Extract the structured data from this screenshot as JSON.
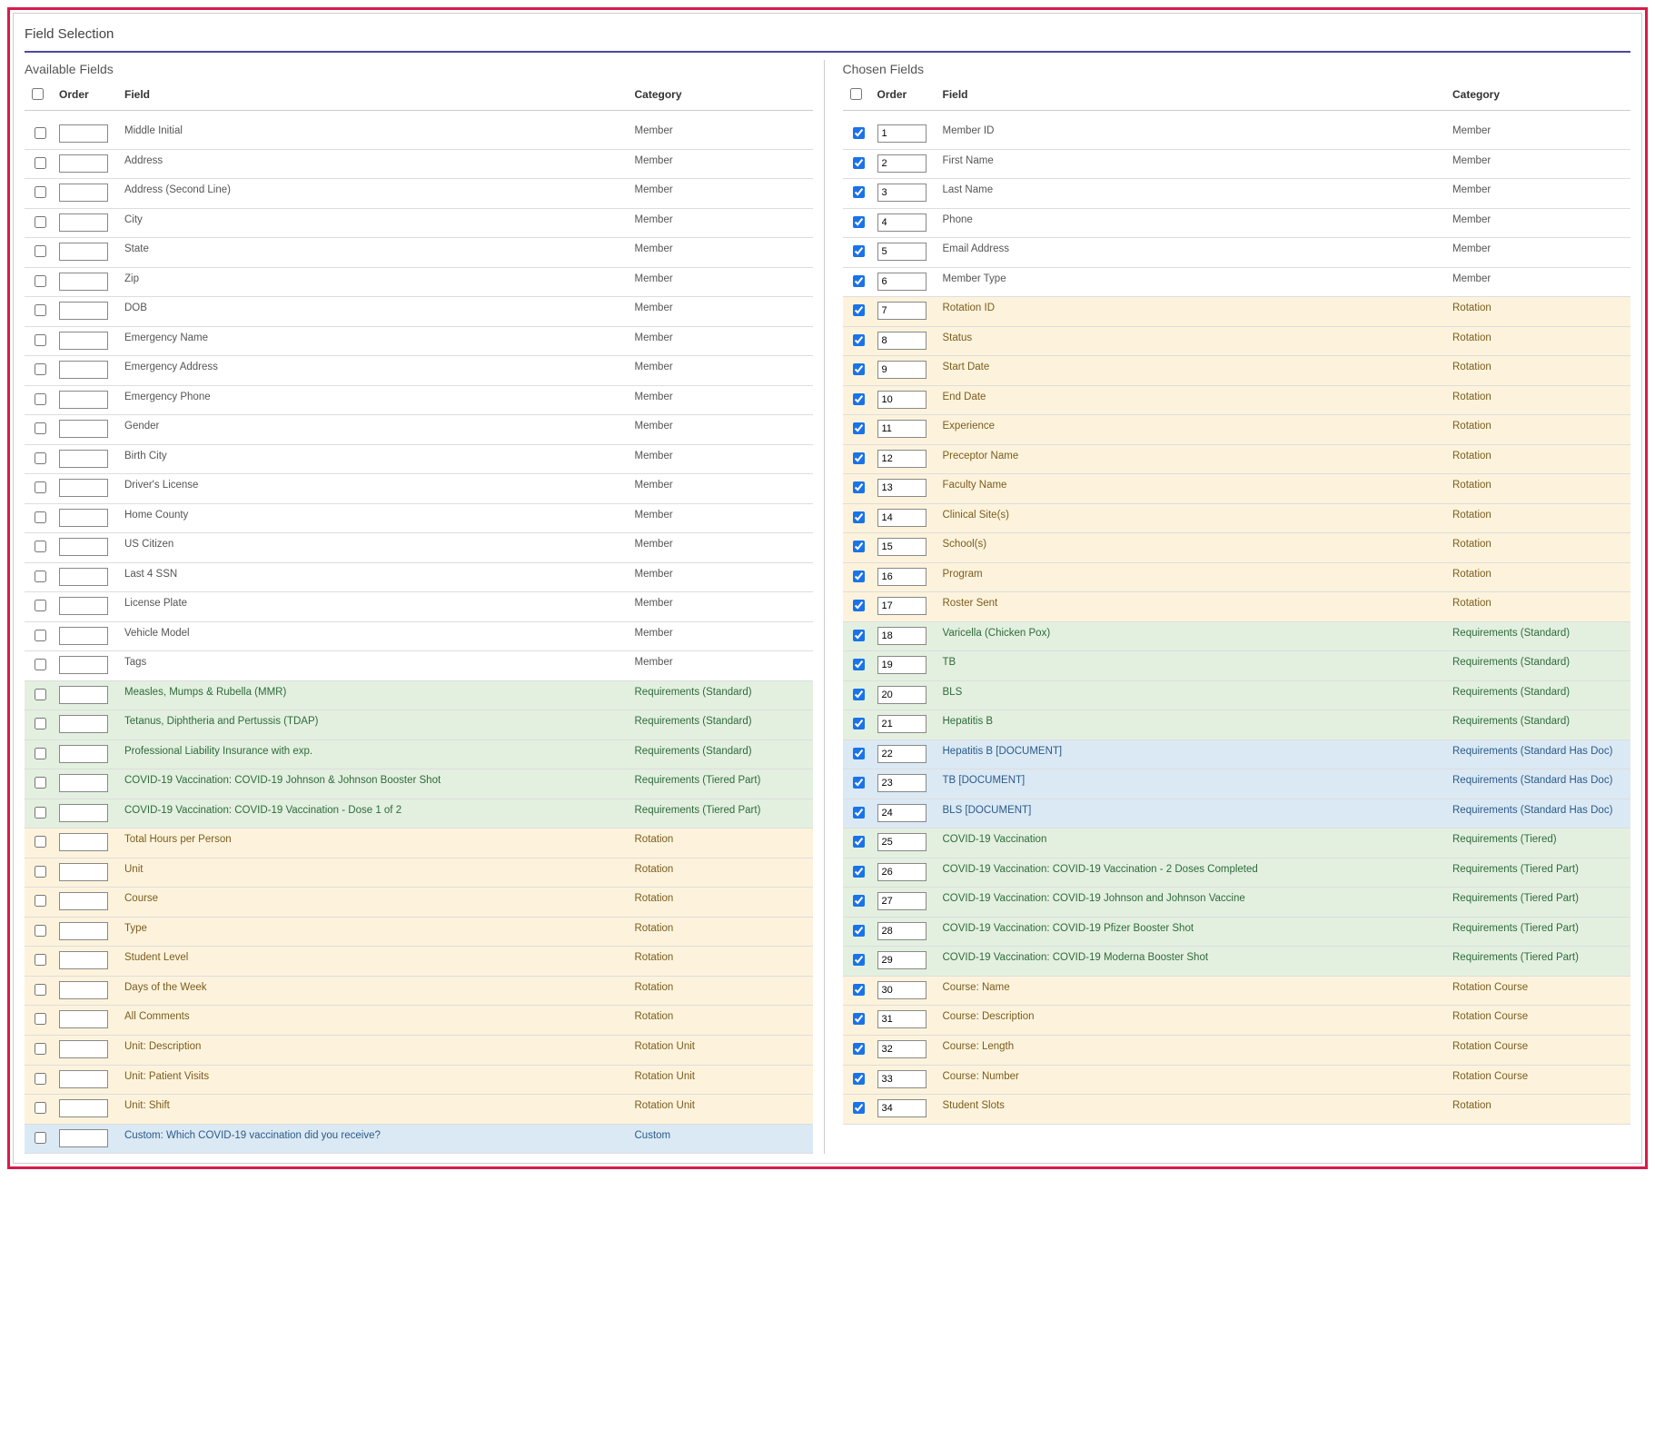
{
  "title": "Field Selection",
  "subtitles": {
    "available": "Available Fields",
    "chosen": "Chosen Fields"
  },
  "headers": {
    "order": "Order",
    "field": "Field",
    "category": "Category"
  },
  "category_labels": {
    "member": "Member",
    "rotation": "Rotation",
    "rotunit": "Rotation Unit",
    "rotcourse": "Rotation Course",
    "reqstd": "Requirements (Standard)",
    "reqdoc": "Requirements (Standard Has Doc)",
    "reqtier": "Requirements (Tiered)",
    "reqtierp": "Requirements (Tiered Part)",
    "custom": "Custom"
  },
  "available_rows": [
    {
      "field": "Middle Initial",
      "cat": "member",
      "order": ""
    },
    {
      "field": "Address",
      "cat": "member",
      "order": ""
    },
    {
      "field": "Address (Second Line)",
      "cat": "member",
      "order": ""
    },
    {
      "field": "City",
      "cat": "member",
      "order": ""
    },
    {
      "field": "State",
      "cat": "member",
      "order": ""
    },
    {
      "field": "Zip",
      "cat": "member",
      "order": ""
    },
    {
      "field": "DOB",
      "cat": "member",
      "order": ""
    },
    {
      "field": "Emergency Name",
      "cat": "member",
      "order": ""
    },
    {
      "field": "Emergency Address",
      "cat": "member",
      "order": ""
    },
    {
      "field": "Emergency Phone",
      "cat": "member",
      "order": ""
    },
    {
      "field": "Gender",
      "cat": "member",
      "order": ""
    },
    {
      "field": "Birth City",
      "cat": "member",
      "order": ""
    },
    {
      "field": "Driver's License",
      "cat": "member",
      "order": ""
    },
    {
      "field": "Home County",
      "cat": "member",
      "order": ""
    },
    {
      "field": "US Citizen",
      "cat": "member",
      "order": ""
    },
    {
      "field": "Last 4 SSN",
      "cat": "member",
      "order": ""
    },
    {
      "field": "License Plate",
      "cat": "member",
      "order": ""
    },
    {
      "field": "Vehicle Model",
      "cat": "member",
      "order": ""
    },
    {
      "field": "Tags",
      "cat": "member",
      "order": ""
    },
    {
      "field": "Measles, Mumps & Rubella (MMR)",
      "cat": "reqstd",
      "order": ""
    },
    {
      "field": "Tetanus, Diphtheria and Pertussis (TDAP)",
      "cat": "reqstd",
      "order": ""
    },
    {
      "field": "Professional Liability Insurance with exp.",
      "cat": "reqstd",
      "order": ""
    },
    {
      "field": "COVID-19 Vaccination: COVID-19 Johnson & Johnson Booster Shot",
      "cat": "reqtierp",
      "order": ""
    },
    {
      "field": "COVID-19 Vaccination: COVID-19 Vaccination - Dose 1 of 2",
      "cat": "reqtierp",
      "order": ""
    },
    {
      "field": "Total Hours per Person",
      "cat": "rotation",
      "order": ""
    },
    {
      "field": "Unit",
      "cat": "rotation",
      "order": ""
    },
    {
      "field": "Course",
      "cat": "rotation",
      "order": ""
    },
    {
      "field": "Type",
      "cat": "rotation",
      "order": ""
    },
    {
      "field": "Student Level",
      "cat": "rotation",
      "order": ""
    },
    {
      "field": "Days of the Week",
      "cat": "rotation",
      "order": ""
    },
    {
      "field": "All Comments",
      "cat": "rotation",
      "order": ""
    },
    {
      "field": "Unit: Description",
      "cat": "rotunit",
      "order": ""
    },
    {
      "field": "Unit: Patient Visits",
      "cat": "rotunit",
      "order": ""
    },
    {
      "field": "Unit: Shift",
      "cat": "rotunit",
      "order": ""
    },
    {
      "field": "Custom: Which COVID-19 vaccination did you receive?",
      "cat": "custom",
      "order": ""
    }
  ],
  "chosen_rows": [
    {
      "field": "Member ID",
      "cat": "member",
      "order": "1",
      "checked": true
    },
    {
      "field": "First Name",
      "cat": "member",
      "order": "2",
      "checked": true
    },
    {
      "field": "Last Name",
      "cat": "member",
      "order": "3",
      "checked": true
    },
    {
      "field": "Phone",
      "cat": "member",
      "order": "4",
      "checked": true
    },
    {
      "field": "Email Address",
      "cat": "member",
      "order": "5",
      "checked": true
    },
    {
      "field": "Member Type",
      "cat": "member",
      "order": "6",
      "checked": true
    },
    {
      "field": "Rotation ID",
      "cat": "rotation",
      "order": "7",
      "checked": true
    },
    {
      "field": "Status",
      "cat": "rotation",
      "order": "8",
      "checked": true
    },
    {
      "field": "Start Date",
      "cat": "rotation",
      "order": "9",
      "checked": true
    },
    {
      "field": "End Date",
      "cat": "rotation",
      "order": "10",
      "checked": true
    },
    {
      "field": "Experience",
      "cat": "rotation",
      "order": "11",
      "checked": true
    },
    {
      "field": "Preceptor Name",
      "cat": "rotation",
      "order": "12",
      "checked": true
    },
    {
      "field": "Faculty Name",
      "cat": "rotation",
      "order": "13",
      "checked": true
    },
    {
      "field": "Clinical Site(s)",
      "cat": "rotation",
      "order": "14",
      "checked": true
    },
    {
      "field": "School(s)",
      "cat": "rotation",
      "order": "15",
      "checked": true
    },
    {
      "field": "Program",
      "cat": "rotation",
      "order": "16",
      "checked": true
    },
    {
      "field": "Roster Sent",
      "cat": "rotation",
      "order": "17",
      "checked": true
    },
    {
      "field": "Varicella (Chicken Pox)",
      "cat": "reqstd",
      "order": "18",
      "checked": true
    },
    {
      "field": "TB",
      "cat": "reqstd",
      "order": "19",
      "checked": true
    },
    {
      "field": "BLS",
      "cat": "reqstd",
      "order": "20",
      "checked": true
    },
    {
      "field": "Hepatitis B",
      "cat": "reqstd",
      "order": "21",
      "checked": true
    },
    {
      "field": "Hepatitis B [DOCUMENT]",
      "cat": "reqdoc",
      "order": "22",
      "checked": true
    },
    {
      "field": "TB [DOCUMENT]",
      "cat": "reqdoc",
      "order": "23",
      "checked": true
    },
    {
      "field": "BLS [DOCUMENT]",
      "cat": "reqdoc",
      "order": "24",
      "checked": true
    },
    {
      "field": "COVID-19 Vaccination",
      "cat": "reqtier",
      "order": "25",
      "checked": true
    },
    {
      "field": "COVID-19 Vaccination: COVID-19 Vaccination - 2 Doses Completed",
      "cat": "reqtierp",
      "order": "26",
      "checked": true
    },
    {
      "field": "COVID-19 Vaccination: COVID-19 Johnson and Johnson Vaccine",
      "cat": "reqtierp",
      "order": "27",
      "checked": true
    },
    {
      "field": "COVID-19 Vaccination: COVID-19 Pfizer Booster Shot",
      "cat": "reqtierp",
      "order": "28",
      "checked": true
    },
    {
      "field": "COVID-19 Vaccination: COVID-19 Moderna Booster Shot",
      "cat": "reqtierp",
      "order": "29",
      "checked": true
    },
    {
      "field": "Course: Name",
      "cat": "rotcourse",
      "order": "30",
      "checked": true
    },
    {
      "field": "Course: Description",
      "cat": "rotcourse",
      "order": "31",
      "checked": true
    },
    {
      "field": "Course: Length",
      "cat": "rotcourse",
      "order": "32",
      "checked": true
    },
    {
      "field": "Course: Number",
      "cat": "rotcourse",
      "order": "33",
      "checked": true
    },
    {
      "field": "Student Slots",
      "cat": "rotation",
      "order": "34",
      "checked": true
    }
  ]
}
